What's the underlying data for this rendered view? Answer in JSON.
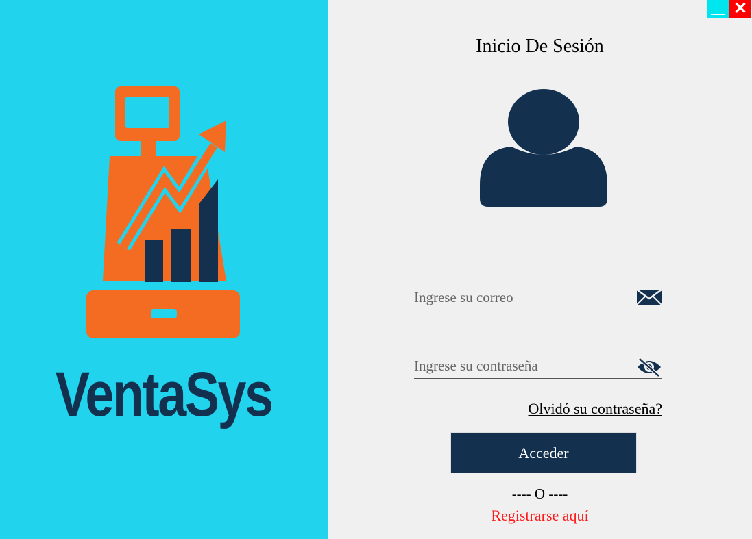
{
  "brand": {
    "name": "VentaSys"
  },
  "window_controls": {
    "minimize": "—",
    "close": "✕"
  },
  "login": {
    "title": "Inicio De Sesión",
    "email_placeholder": "Ingrese su correo",
    "password_placeholder": "Ingrese su contraseña",
    "forgot_link": "Olvidó su contraseña?",
    "submit_label": "Acceder",
    "separator": "---- O ----",
    "register_link": "Registrarse aquí"
  },
  "icons": {
    "email": "envelope-icon",
    "password_toggle": "eye-slash-icon",
    "avatar": "user-icon",
    "logo": "cash-register-growth-chart-icon"
  },
  "colors": {
    "left_panel": "#21d3ed",
    "right_panel": "#f0f0f0",
    "navy": "#13304e",
    "orange": "#f36c21",
    "register_link": "#ff1a1a",
    "close_button": "#ff0000",
    "minimize_button": "#00e6ef"
  }
}
